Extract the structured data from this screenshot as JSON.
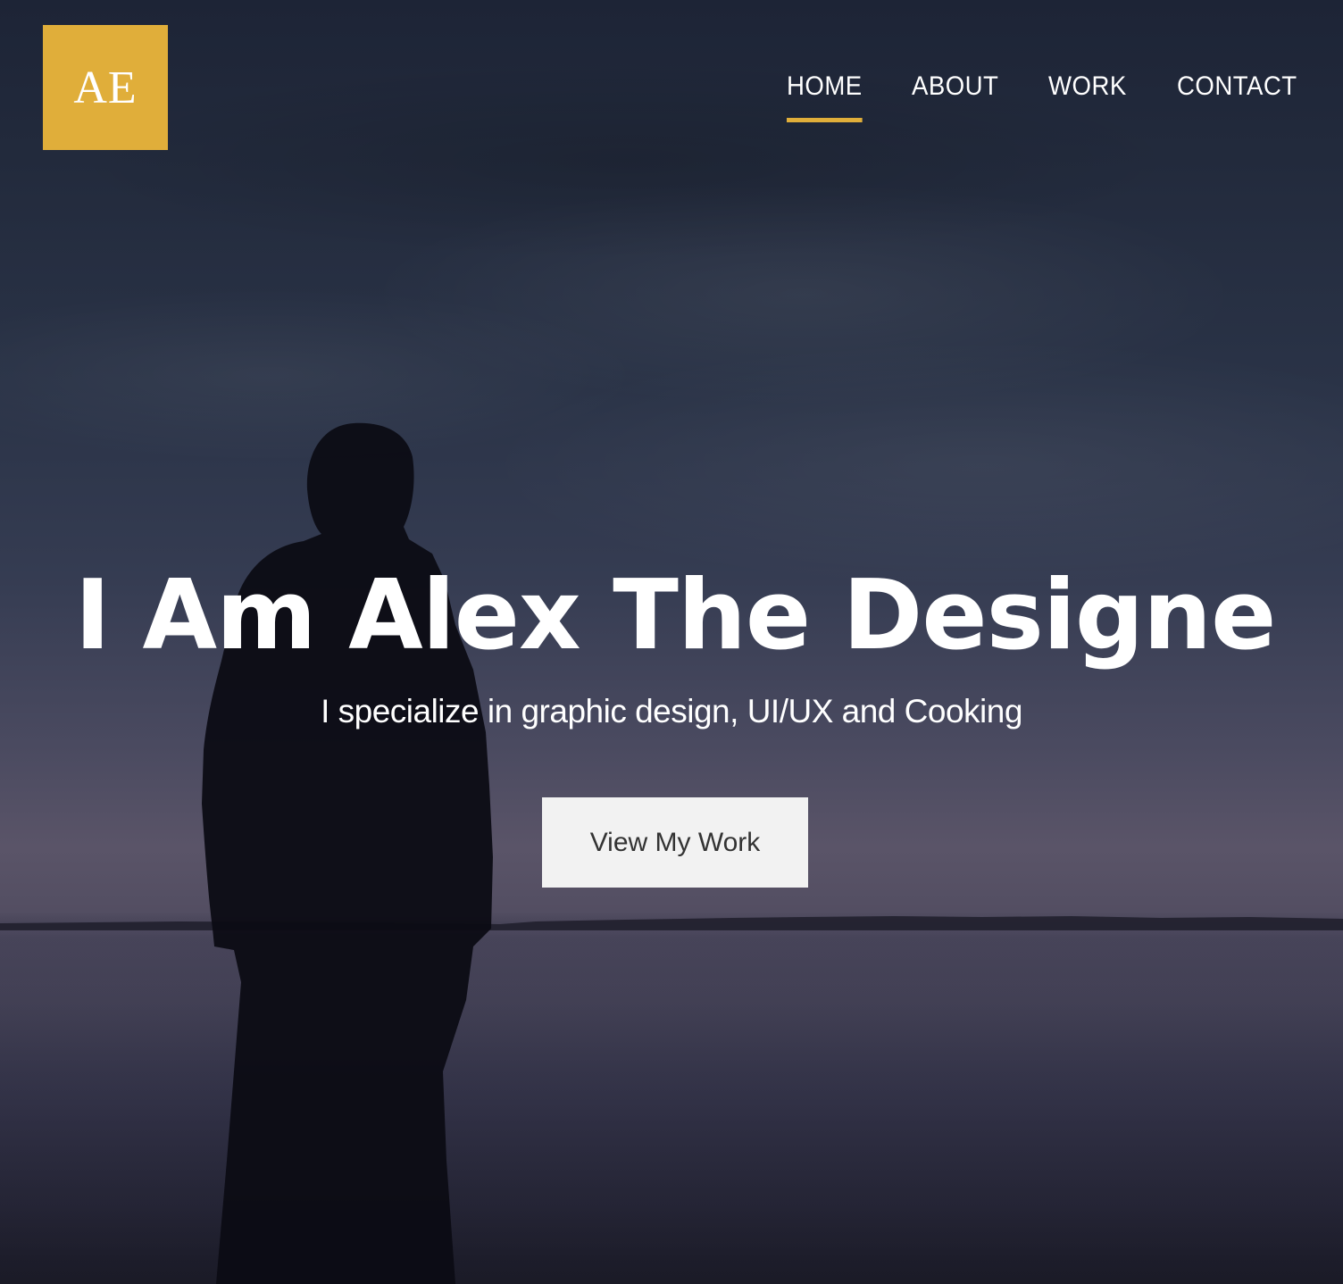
{
  "logo": {
    "text": "AE"
  },
  "nav": {
    "items": [
      {
        "label": "HOME",
        "active": true
      },
      {
        "label": "ABOUT",
        "active": false
      },
      {
        "label": "WORK",
        "active": false
      },
      {
        "label": "CONTACT",
        "active": false
      }
    ]
  },
  "hero": {
    "headline": "I Am Alex The Designe",
    "subtitle": "I specialize in graphic design, UI/UX and Cooking",
    "cta_label": "View My Work"
  },
  "colors": {
    "accent": "#e0ae3a",
    "button_bg": "#f2f2f2",
    "text": "#ffffff"
  }
}
